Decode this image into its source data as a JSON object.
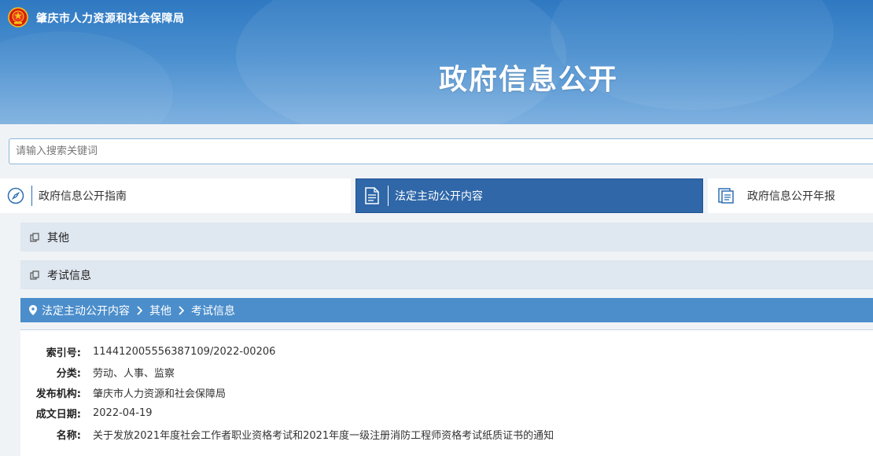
{
  "header": {
    "org_name": "肇庆市人力资源和社会保障局",
    "title": "政府信息公开"
  },
  "search": {
    "placeholder": "请输入搜索关键词"
  },
  "tabs": [
    {
      "label": "政府信息公开指南",
      "icon": "compass-icon",
      "active": false
    },
    {
      "label": "法定主动公开内容",
      "icon": "document-icon",
      "active": true
    },
    {
      "label": "政府信息公开年报",
      "icon": "report-icon",
      "active": false
    }
  ],
  "categories": [
    {
      "label": "其他",
      "icon": "copy-icon"
    },
    {
      "label": "考试信息",
      "icon": "copy-icon"
    }
  ],
  "breadcrumb": {
    "icon": "location-pin-icon",
    "items": [
      "法定主动公开内容",
      "其他",
      "考试信息"
    ]
  },
  "details": [
    {
      "key": "索引号:",
      "value": "114412005556387109/2022-00206"
    },
    {
      "key": "分类:",
      "value": "劳动、人事、监察"
    },
    {
      "key": "发布机构:",
      "value": "肇庆市人力资源和社会保障局"
    },
    {
      "key": "成文日期:",
      "value": "2022-04-19"
    },
    {
      "key": "名称:",
      "value": "关于发放2021年度社会工作者职业资格考试和2021年度一级注册消防工程师资格考试纸质证书的通知"
    }
  ],
  "colors": {
    "banner": "#3a82c8",
    "active_tab": "#2f67a8",
    "breadcrumb_bar": "#4b8ecb",
    "category_bg": "#dfe7f0"
  }
}
